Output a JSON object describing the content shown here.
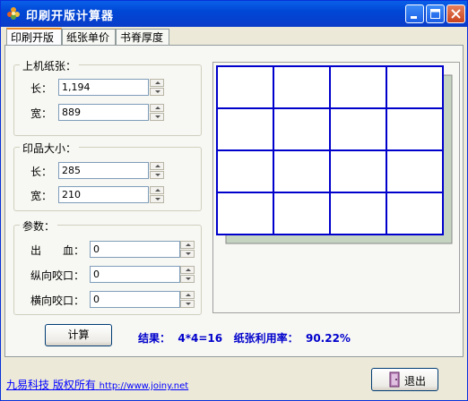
{
  "window": {
    "title": "印刷开版计算器"
  },
  "titlebar_buttons": {
    "minimize": "minimize-icon",
    "maximize": "maximize-icon",
    "close": "close-icon"
  },
  "tabs": [
    {
      "label": "印刷开版",
      "active": true
    },
    {
      "label": "纸张单价",
      "active": false
    },
    {
      "label": "书脊厚度",
      "active": false
    }
  ],
  "paper_group": {
    "title": "上机纸张：",
    "length_label": "长：",
    "length_value": "1,194",
    "width_label": "宽：",
    "width_value": "889"
  },
  "product_group": {
    "title": "印品大小：",
    "length_label": "长：",
    "length_value": "285",
    "width_label": "宽：",
    "width_value": "210"
  },
  "params_group": {
    "title": "参数：",
    "bleed_label": "出　　血：",
    "bleed_value": "0",
    "vgrip_label": "纵向咬口：",
    "vgrip_value": "0",
    "hgrip_label": "横向咬口：",
    "hgrip_value": "0"
  },
  "preview": {
    "rows": 4,
    "cols": 4,
    "grid_color": "#0000cc",
    "shadow_color": "#c5d4c0"
  },
  "calc_button": "计算",
  "result": "结果：  4*4=16   纸张利用率：  90.22%",
  "footer": {
    "company": "九易科技 版权所有",
    "url": "http://www.joiny.net"
  },
  "exit_button": "退出",
  "colors": {
    "titlebar": "#0a5fe8",
    "accent_tab": "#e68b2c",
    "result_text": "#0000cc"
  }
}
